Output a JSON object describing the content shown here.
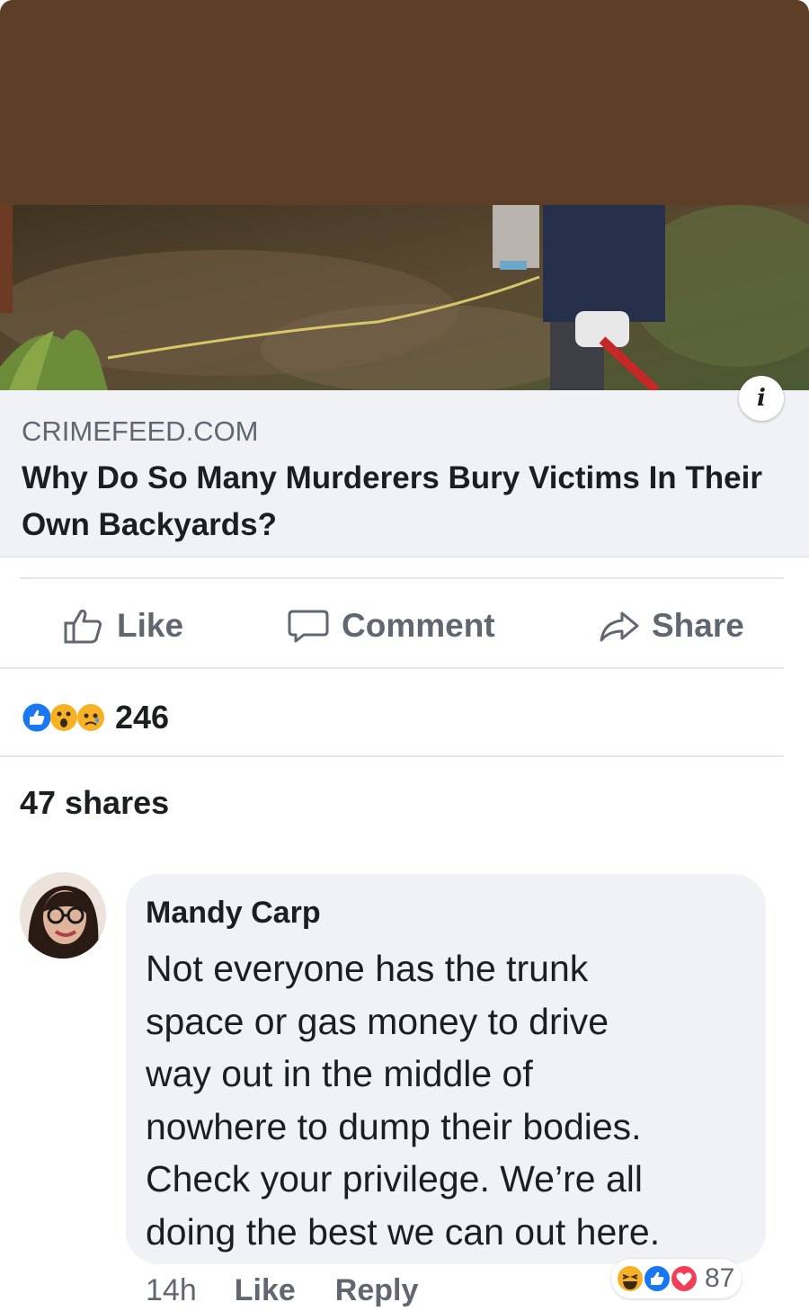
{
  "post": {
    "link": {
      "domain": "CRIMEFEED.COM",
      "headline": "Why Do So Many Murderers Bury Victims In Their Own Backyards?",
      "info_icon": "info-icon"
    },
    "actions": {
      "like_label": "Like",
      "comment_label": "Comment",
      "share_label": "Share",
      "like_icon": "thumbs-up-outline-icon",
      "comment_icon": "speech-bubble-icon",
      "share_icon": "share-arrow-icon"
    },
    "reactions": {
      "icons": [
        "like-reaction-icon",
        "wow-reaction-icon",
        "sad-reaction-icon"
      ],
      "count": "246"
    },
    "shares_text": "47 shares"
  },
  "comment": {
    "author": "Mandy Carp",
    "lines": [
      "Not everyone has the trunk",
      "space or gas money to drive",
      "way out in the middle of",
      "nowhere to dump their bodies.",
      "Check your privilege. We’re all",
      "doing the best we can out here."
    ],
    "time": "14h",
    "like_label": "Like",
    "reply_label": "Reply",
    "reactions": {
      "icons": [
        "haha-reaction-icon",
        "like-reaction-icon",
        "love-reaction-icon"
      ],
      "count": "87"
    }
  },
  "colors": {
    "top_band": "#5c3f26",
    "link_box_bg": "#f0f2f5",
    "secondary_text": "#606770",
    "primary_text": "#1c1e21",
    "like_blue": "#1877f2",
    "love_red": "#f33e58",
    "reaction_yellow": "#f7b125"
  }
}
